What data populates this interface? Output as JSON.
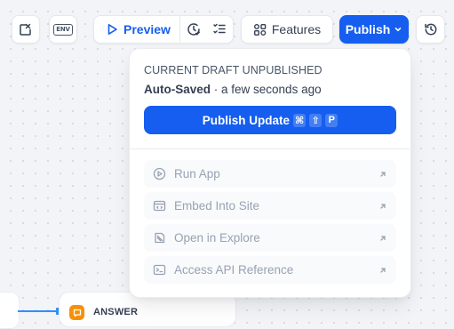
{
  "toolbar": {
    "env_badge": "ENV",
    "preview_label": "Preview",
    "features_label": "Features",
    "publish_label": "Publish"
  },
  "publish_menu": {
    "draft_status": "CURRENT DRAFT UNPUBLISHED",
    "autosaved_label": "Auto-Saved",
    "autosaved_sep": " · ",
    "autosaved_time": "a few seconds ago",
    "publish_update_label": "Publish Update",
    "shortcut_keys": [
      "⌘",
      "⇧",
      "P"
    ],
    "items": [
      {
        "label": "Run App",
        "icon": "play-circle-icon"
      },
      {
        "label": "Embed Into Site",
        "icon": "embed-icon"
      },
      {
        "label": "Open in Explore",
        "icon": "explore-icon"
      },
      {
        "label": "Access API Reference",
        "icon": "terminal-icon"
      }
    ]
  },
  "canvas": {
    "answer_node_label": "ANSWER"
  },
  "colors": {
    "accent": "#155eef",
    "disabled_text": "#98a2b3",
    "answer_icon_bg": "#f79009"
  }
}
